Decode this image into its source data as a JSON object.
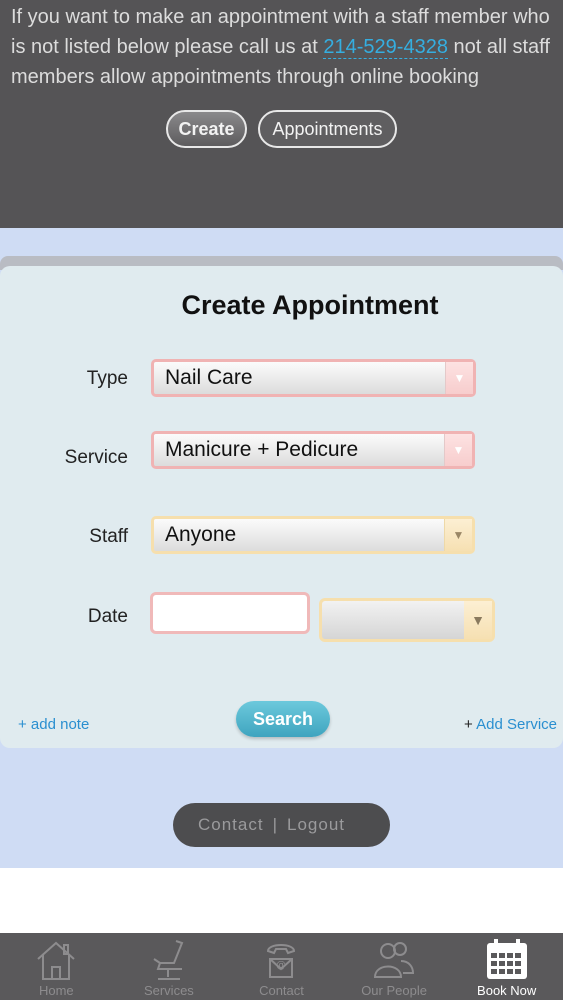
{
  "header": {
    "info_before": "If you want to make an appointment with a staff member who is not listed below please call us at ",
    "phone": "214-529-4328",
    "info_after": " not all staff members allow appointments through online booking",
    "btn_create": "Create",
    "btn_appointments": "Appointments"
  },
  "form": {
    "title": "Create Appointment",
    "type_label": "Type",
    "type_value": "Nail Care",
    "service_label": "Service",
    "service_value": "Manicure + Pedicure",
    "staff_label": "Staff",
    "staff_value": "Anyone",
    "date_label": "Date",
    "date_value": "",
    "time_value": "",
    "add_note": "+ add note",
    "search": "Search",
    "add_service_plus": "+",
    "add_service": "Add Service",
    "arrow_glyph": "▼"
  },
  "footer": {
    "contact": "Contact",
    "separator": "|",
    "logout": "Logout"
  },
  "tabs": [
    {
      "label": "Home",
      "icon": "home-icon"
    },
    {
      "label": "Services",
      "icon": "barber-chair-icon"
    },
    {
      "label": "Contact",
      "icon": "contact-icon"
    },
    {
      "label": "Our People",
      "icon": "people-icon"
    },
    {
      "label": "Book Now",
      "icon": "calendar-icon",
      "active": true
    }
  ],
  "colors": {
    "header_bg": "#555456",
    "page_bg": "#cfdcf4",
    "card_bg": "#e0ebef",
    "link": "#2a8fd0",
    "search_button": "#4ab2c9",
    "tabbar_bg": "#5a595b"
  }
}
